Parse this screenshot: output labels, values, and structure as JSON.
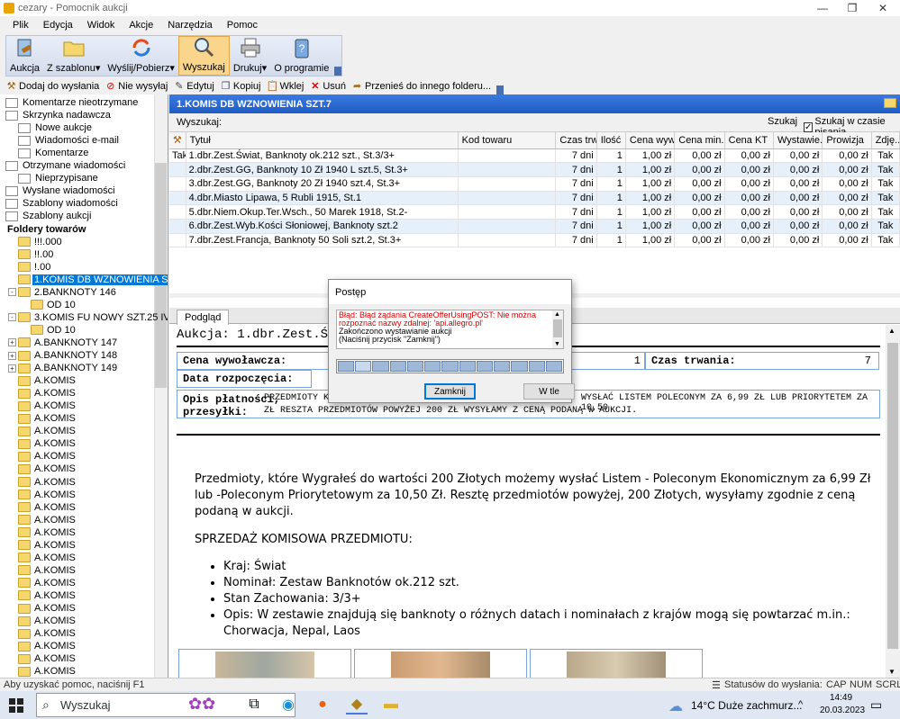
{
  "window": {
    "title": "cezary - Pomocnik aukcji"
  },
  "menu": [
    "Plik",
    "Edycja",
    "Widok",
    "Akcje",
    "Narzędzia",
    "Pomoc"
  ],
  "toolbar": {
    "buttons": [
      {
        "label": "Aukcja",
        "icon": "gavel-icon"
      },
      {
        "label": "Z szablonu",
        "icon": "folder-open-icon",
        "dropdown": true
      },
      {
        "label": "Wyślij/Pobierz",
        "icon": "sync-icon",
        "dropdown": true
      },
      {
        "label": "Wyszukaj",
        "icon": "magnifier-icon",
        "active": true
      },
      {
        "label": "Drukuj",
        "icon": "printer-icon",
        "dropdown": true
      },
      {
        "label": "O programie",
        "icon": "help-icon"
      }
    ]
  },
  "toolbar2": {
    "buttons": [
      {
        "label": "Dodaj do wysłania",
        "icon": "gavel-add-icon"
      },
      {
        "label": "Nie wysyłaj",
        "icon": "no-send-icon"
      },
      {
        "label": "Edytuj",
        "icon": "edit-icon"
      },
      {
        "label": "Kopiuj",
        "icon": "copy-icon"
      },
      {
        "label": "Wklej",
        "icon": "paste-icon"
      },
      {
        "label": "Usuń",
        "icon": "delete-icon"
      },
      {
        "label": "Przenieś do innego folderu...",
        "icon": "move-icon"
      }
    ]
  },
  "sidebar": {
    "items": [
      {
        "label": "Komentarze nieotrzymane",
        "indent": 0,
        "icon": "list"
      },
      {
        "label": "Skrzynka nadawcza",
        "indent": 0,
        "icon": "envelope"
      },
      {
        "label": "Nowe aukcje",
        "indent": 1,
        "icon": "envelope"
      },
      {
        "label": "Wiadomości e-mail",
        "indent": 1,
        "icon": "envelope"
      },
      {
        "label": "Komentarze",
        "indent": 1,
        "icon": "envelope"
      },
      {
        "label": "Otrzymane wiadomości",
        "indent": 0,
        "icon": "envelope"
      },
      {
        "label": "Nieprzypisane",
        "indent": 1,
        "icon": "envelope"
      },
      {
        "label": "Wysłane wiadomości",
        "indent": 0,
        "icon": "envelope"
      },
      {
        "label": "Szablony wiadomości",
        "indent": 0,
        "icon": "envelope"
      },
      {
        "label": "Szablony aukcji",
        "indent": 0,
        "icon": "envelope"
      },
      {
        "label": "Foldery towarów",
        "indent": 0,
        "icon": "none",
        "bold": true
      },
      {
        "label": "!!!.000",
        "indent": 1,
        "icon": "folder"
      },
      {
        "label": "!!.00",
        "indent": 1,
        "icon": "folder"
      },
      {
        "label": "!.00",
        "indent": 1,
        "icon": "folder"
      },
      {
        "label": "1.KOMIS DB WZNOWIENIA SZT.7",
        "indent": 1,
        "icon": "folder",
        "selected": true
      },
      {
        "label": "2.BANKNOTY 146",
        "indent": 1,
        "icon": "folder",
        "expand": "-"
      },
      {
        "label": "OD 10",
        "indent": 2,
        "icon": "folder"
      },
      {
        "label": "3.KOMIS FU NOWY SZT.25 IV",
        "indent": 1,
        "icon": "folder",
        "expand": "-"
      },
      {
        "label": "OD 10",
        "indent": 2,
        "icon": "folder"
      },
      {
        "label": "A.BANKNOTY 147",
        "indent": 1,
        "icon": "folder",
        "expand": "+"
      },
      {
        "label": "A.BANKNOTY 148",
        "indent": 1,
        "icon": "folder",
        "expand": "+"
      },
      {
        "label": "A.BANKNOTY 149",
        "indent": 1,
        "icon": "folder",
        "expand": "+"
      },
      {
        "label": "A.KOMIS",
        "indent": 1,
        "icon": "folder"
      },
      {
        "label": "A.KOMIS",
        "indent": 1,
        "icon": "folder"
      },
      {
        "label": "A.KOMIS",
        "indent": 1,
        "icon": "folder"
      },
      {
        "label": "A.KOMIS",
        "indent": 1,
        "icon": "folder"
      },
      {
        "label": "A.KOMIS",
        "indent": 1,
        "icon": "folder"
      },
      {
        "label": "A.KOMIS",
        "indent": 1,
        "icon": "folder"
      },
      {
        "label": "A.KOMIS",
        "indent": 1,
        "icon": "folder"
      },
      {
        "label": "A.KOMIS",
        "indent": 1,
        "icon": "folder"
      },
      {
        "label": "A.KOMIS",
        "indent": 1,
        "icon": "folder"
      },
      {
        "label": "A.KOMIS",
        "indent": 1,
        "icon": "folder"
      },
      {
        "label": "A.KOMIS",
        "indent": 1,
        "icon": "folder"
      },
      {
        "label": "A.KOMIS",
        "indent": 1,
        "icon": "folder"
      },
      {
        "label": "A.KOMIS",
        "indent": 1,
        "icon": "folder"
      },
      {
        "label": "A.KOMIS",
        "indent": 1,
        "icon": "folder"
      },
      {
        "label": "A.KOMIS",
        "indent": 1,
        "icon": "folder"
      },
      {
        "label": "A.KOMIS",
        "indent": 1,
        "icon": "folder"
      },
      {
        "label": "A.KOMIS",
        "indent": 1,
        "icon": "folder"
      },
      {
        "label": "A.KOMIS",
        "indent": 1,
        "icon": "folder"
      },
      {
        "label": "A.KOMIS",
        "indent": 1,
        "icon": "folder"
      },
      {
        "label": "A.KOMIS",
        "indent": 1,
        "icon": "folder"
      },
      {
        "label": "A.KOMIS",
        "indent": 1,
        "icon": "folder"
      },
      {
        "label": "A.KOMIS",
        "indent": 1,
        "icon": "folder"
      },
      {
        "label": "A.KOMIS",
        "indent": 1,
        "icon": "folder"
      },
      {
        "label": "A.KOMIS",
        "indent": 1,
        "icon": "folder"
      }
    ]
  },
  "main": {
    "header": "1.KOMIS DB WZNOWIENIA SZT.7",
    "search": {
      "label": "Wyszukaj:",
      "button": "Szukaj",
      "checkbox": "Szukaj w czasie pisania",
      "checked": true
    },
    "columns": [
      "Tytuł",
      "Kod towaru",
      "Czas trw...",
      "Ilość",
      "Cena wyw.",
      "Cena min.",
      "Cena KT",
      "Wystawie...",
      "Prowizja",
      "Zdję..."
    ],
    "rows": [
      [
        "Tak",
        "1.dbr.Zest.Świat, Banknoty ok.212 szt., St.3/3+",
        "",
        "7 dni",
        "1",
        "1,00 zł",
        "0,00 zł",
        "0,00 zł",
        "0,00 zł",
        "0,00 zł",
        "Tak"
      ],
      [
        "",
        "2.dbr.Zest.GG, Banknoty 10 Zł 1940 L szt.5, St.3+",
        "",
        "7 dni",
        "1",
        "1,00 zł",
        "0,00 zł",
        "0,00 zł",
        "0,00 zł",
        "0,00 zł",
        "Tak"
      ],
      [
        "",
        "3.dbr.Zest.GG, Banknoty 20 Zł 1940 szt.4, St.3+",
        "",
        "7 dni",
        "1",
        "1,00 zł",
        "0,00 zł",
        "0,00 zł",
        "0,00 zł",
        "0,00 zł",
        "Tak"
      ],
      [
        "",
        "4.dbr.Miasto Lipawa, 5 Rubli 1915, St.1",
        "",
        "7 dni",
        "1",
        "1,00 zł",
        "0,00 zł",
        "0,00 zł",
        "0,00 zł",
        "0,00 zł",
        "Tak"
      ],
      [
        "",
        "5.dbr.Niem.Okup.Ter.Wsch., 50 Marek 1918, St.2-",
        "",
        "7 dni",
        "1",
        "1,00 zł",
        "0,00 zł",
        "0,00 zł",
        "0,00 zł",
        "0,00 zł",
        "Tak"
      ],
      [
        "",
        "6.dbr.Zest.Wyb.Kości Słoniowej, Banknoty szt.2",
        "",
        "7 dni",
        "1",
        "1,00 zł",
        "0,00 zł",
        "0,00 zł",
        "0,00 zł",
        "0,00 zł",
        "Tak"
      ],
      [
        "",
        "7.dbr.Zest.Francja, Banknoty 50 Soli szt.2, St.3+",
        "",
        "7 dni",
        "1",
        "1,00 zł",
        "0,00 zł",
        "0,00 zł",
        "0,00 zł",
        "0,00 zł",
        "Tak"
      ]
    ]
  },
  "preview": {
    "tab": "Podgląd",
    "auction_title": "Aukcja: 1.dbr.Zest.Świat, Ba",
    "price_label": "Cena wywoławcza:",
    "quantity": "1",
    "duration_label": "Czas trwania:",
    "duration": "7",
    "start_label": "Data rozpoczęcia:",
    "payment_label_1": "Opis płatności,",
    "payment_label_2": "przesyłki:",
    "payment_text_1": "PRZEDMIOTY K",
    "payment_text_1b": "WYSŁAĆ LISTEM POLECONYM ZA 6,99 ZŁ LUB PRIORYTETEM ZA 10,50",
    "payment_text_2": "ZŁ RESZTA PRZEDMIOTÓW POWYŻEJ 200 ZŁ WYSYŁAMY Z CENĄ PODANĄ W AUKCJI.",
    "body_p1": "Przedmioty, które Wygrałeś do wartości 200 Złotych możemy wysłać  Listem - Poleconym Ekonomicznym za 6,99 Zł lub -Poleconym Priorytetowym za 10,50 Zł. Resztę przedmiotów powyżej, 200 Złotych, wysyłamy zgodnie z ceną podaną w aukcji.",
    "body_h": "SPRZEDAŻ KOMISOWA PRZEDMIOTU:",
    "bullets": [
      "Kraj: Świat",
      "Nominał: Zestaw Banknotów ok.212 szt.",
      "Stan Zachowania: 3/3+",
      "Opis: W zestawie znajdują się banknoty o różnych datach i nominałach z krajów mogą się powtarzać m.in.: Chorwacja, Nepal, Laos"
    ]
  },
  "dialog": {
    "title": "Postęp",
    "log_error": "Błąd: Błąd żądania CreateOfferUsingPOST: Nie można rozpoznać nazwy zdalnej: 'api.allegro.pl'",
    "log_line2": "Zakończono wystawianie aukcji",
    "log_line3": "(Naciśnij przycisk \"Zamknij\")",
    "close_button": "Zamknij",
    "background_button": "W tle",
    "progress_cells": 13
  },
  "status": {
    "help": "Aby uzyskać pomoc, naciśnij F1",
    "queue": "Statusów do wysłania:",
    "caps": "CAP",
    "num": "NUM",
    "scrl": "SCRL"
  },
  "taskbar": {
    "search_placeholder": "Wyszukaj",
    "weather": "14°C  Duże zachmurz...",
    "time": "14:49",
    "date": "20.03.2023"
  },
  "colors": {
    "header_blue": "#1f5cc4",
    "selection": "#0078d7",
    "error_red": "#d00000",
    "active_toolbar": "#f9d68c"
  }
}
